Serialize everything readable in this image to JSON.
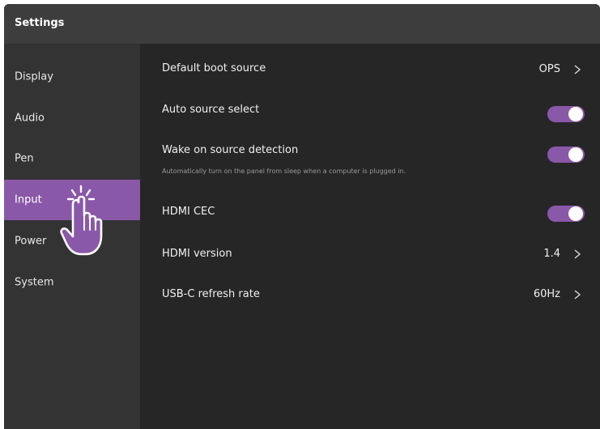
{
  "window": {
    "title": "Settings"
  },
  "sidebar": {
    "items": [
      {
        "label": "Display",
        "active": false
      },
      {
        "label": "Audio",
        "active": false
      },
      {
        "label": "Pen",
        "active": false
      },
      {
        "label": "Input",
        "active": true
      },
      {
        "label": "Power",
        "active": false
      },
      {
        "label": "System",
        "active": false
      }
    ]
  },
  "content": {
    "default_boot_source": {
      "label": "Default boot source",
      "value": "OPS"
    },
    "auto_source_select": {
      "label": "Auto source select",
      "enabled": true
    },
    "wake_on_source_detection": {
      "label": "Wake on source detection",
      "description": "Automatically turn on the panel from sleep when a computer is plugged in.",
      "enabled": true
    },
    "hdmi_cec": {
      "label": "HDMI CEC",
      "enabled": true
    },
    "hdmi_version": {
      "label": "HDMI version",
      "value": "1.4"
    },
    "usbc_refresh_rate": {
      "label": "USB-C refresh rate",
      "value": "60Hz"
    }
  },
  "icons": {
    "chevron": "chevron-right-icon",
    "pointer": "hand-pointer-icon"
  },
  "colors": {
    "accent": "#8a58a8",
    "titlebar": "#3d3d3d",
    "sidebar": "#333333",
    "content": "#262626",
    "text": "#f0f0f0",
    "description": "#9a9a9a"
  }
}
